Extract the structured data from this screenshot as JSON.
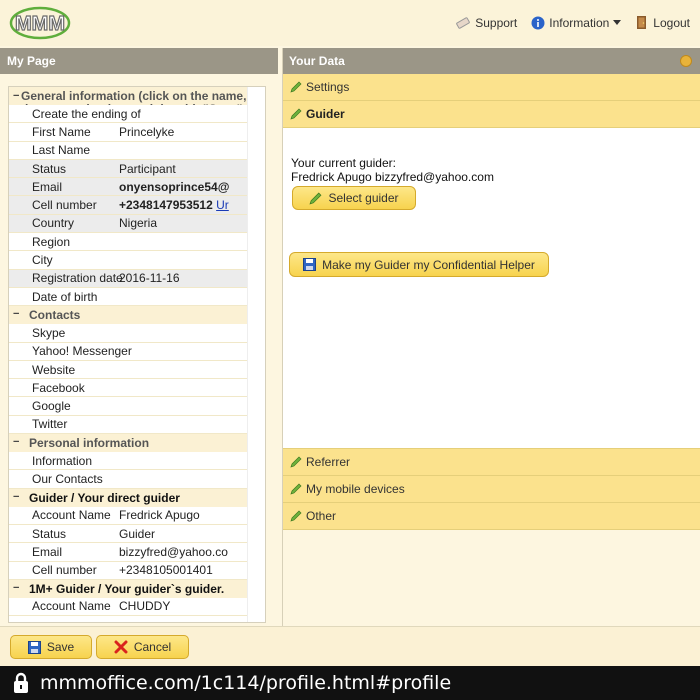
{
  "topbar": {
    "logo_text": "MMM",
    "nav": [
      {
        "label": "Support",
        "icon": "pencil-eraser-icon"
      },
      {
        "label": "Information",
        "icon": "info-icon"
      },
      {
        "label": "Logout",
        "icon": "logout-icon"
      }
    ]
  },
  "left": {
    "title": "My Page",
    "general": {
      "toggle": "−",
      "heading": "General information (click on the name, then enter the data and then hit \"Save\"",
      "rows": [
        {
          "label": "Create the ending of",
          "value": "",
          "shaded": false
        },
        {
          "label": "First Name",
          "value": "Princelyke",
          "shaded": false
        },
        {
          "label": "Last Name",
          "value": "",
          "shaded": false
        },
        {
          "label": "Status",
          "value": "Participant",
          "shaded": true
        },
        {
          "label": "Email",
          "value": "onyensoprince54@",
          "shaded": true,
          "bold": true
        },
        {
          "label": "Cell number",
          "value": "+2348147953512",
          "link": "Ur",
          "shaded": true,
          "bold": true
        },
        {
          "label": "Country",
          "value": "Nigeria",
          "shaded": true
        },
        {
          "label": "Region",
          "value": "",
          "shaded": false
        },
        {
          "label": "City",
          "value": "",
          "shaded": false
        },
        {
          "label": "Registration date",
          "value": "2016-11-16",
          "shaded": true
        },
        {
          "label": "Date of birth",
          "value": "",
          "shaded": false
        }
      ]
    },
    "contacts": {
      "heading": "Contacts",
      "rows": [
        {
          "label": "Skype",
          "value": ""
        },
        {
          "label": "Yahoo! Messenger",
          "value": ""
        },
        {
          "label": "Website",
          "value": ""
        },
        {
          "label": "Facebook",
          "value": ""
        },
        {
          "label": "Google",
          "value": ""
        },
        {
          "label": "Twitter",
          "value": ""
        }
      ]
    },
    "personal": {
      "heading": "Personal information",
      "rows": [
        {
          "label": "Information",
          "value": ""
        },
        {
          "label": "Our Contacts",
          "value": ""
        }
      ]
    },
    "guider": {
      "heading": "Guider / Your direct guider",
      "rows": [
        {
          "label": "Account Name",
          "value": "Fredrick Apugo"
        },
        {
          "label": "Status",
          "value": "Guider"
        },
        {
          "label": "Email",
          "value": "bizzyfred@yahoo.co"
        },
        {
          "label": "Cell number",
          "value": "+2348105001401"
        }
      ]
    },
    "guider2": {
      "heading": "1M+ Guider / Your guider`s guider.",
      "rows": [
        {
          "label": "Account Name",
          "value": "CHUDDY"
        }
      ]
    }
  },
  "right": {
    "title": "Your Data",
    "accordion": {
      "settings": "Settings",
      "guider": "Guider",
      "referrer": "Referrer",
      "mobile": "My mobile devices",
      "other": "Other"
    },
    "guider_body": {
      "line1": "Your current guider:",
      "line2": "Fredrick Apugo bizzyfred@yahoo.com",
      "select_btn": "Select guider",
      "confidential_btn": "Make my Guider my Confidential Helper"
    }
  },
  "footer": {
    "save": "Save",
    "cancel": "Cancel"
  },
  "urlbar": {
    "url": "mmmoffice.com/1c114/profile.html#profile"
  }
}
